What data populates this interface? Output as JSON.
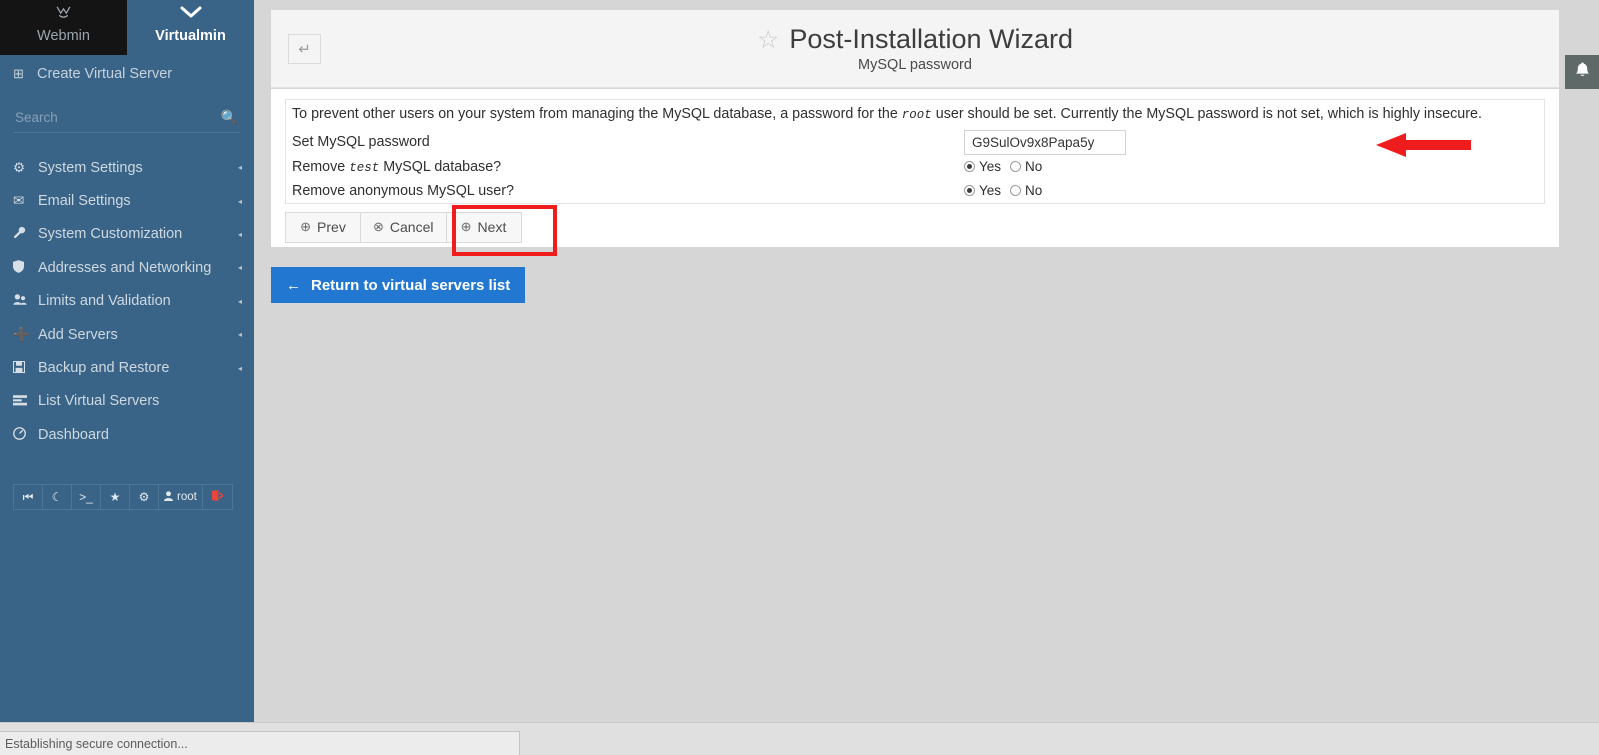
{
  "sidebar": {
    "brand_tabs": [
      {
        "label": "Webmin",
        "icon": "webmin-logo-icon",
        "active": false
      },
      {
        "label": "Virtualmin",
        "icon": "chevron-down-icon",
        "active": true
      }
    ],
    "create_virtual_server": {
      "label": "Create Virtual Server",
      "icon": "plus-square-icon"
    },
    "search": {
      "placeholder": "Search",
      "value": "",
      "icon": "search-icon"
    },
    "items": [
      {
        "label": "System Settings",
        "icon": "gear-icon",
        "arrow": "◂"
      },
      {
        "label": "Email Settings",
        "icon": "envelope-icon",
        "arrow": "◂"
      },
      {
        "label": "System Customization",
        "icon": "wrench-icon",
        "arrow": "◂"
      },
      {
        "label": "Addresses and Networking",
        "icon": "shield-icon",
        "arrow": "◂"
      },
      {
        "label": "Limits and Validation",
        "icon": "users-icon",
        "arrow": "◂"
      },
      {
        "label": "Add Servers",
        "icon": "plus-icon",
        "arrow": "◂"
      },
      {
        "label": "Backup and Restore",
        "icon": "save-icon",
        "arrow": "◂"
      },
      {
        "label": "List Virtual Servers",
        "icon": "list-icon",
        "arrow": ""
      },
      {
        "label": "Dashboard",
        "icon": "dashboard-icon",
        "arrow": ""
      }
    ],
    "mini_toolbar": [
      {
        "name": "collapse-sidebar-button",
        "glyph": "⏮",
        "label": ""
      },
      {
        "name": "night-mode-button",
        "glyph": "☾",
        "label": ""
      },
      {
        "name": "terminal-button",
        "glyph": ">_",
        "label": ""
      },
      {
        "name": "favorites-button",
        "glyph": "★",
        "label": ""
      },
      {
        "name": "theme-config-button",
        "glyph": "⚙",
        "label": ""
      },
      {
        "name": "user-button",
        "glyph": "👤",
        "label": "root"
      },
      {
        "name": "logout-button",
        "glyph": "➜",
        "label": ""
      }
    ]
  },
  "header": {
    "back_icon": "back-arrow-icon",
    "star_icon": "star-outline-icon",
    "title": "Post-Installation Wizard",
    "subtitle": "MySQL password",
    "bell_icon": "bell-icon"
  },
  "form": {
    "intro_part1": "To prevent other users on your system from managing the MySQL database, a password for the ",
    "intro_mono": "root",
    "intro_part2": " user should be set. Currently the MySQL password is not set, which is highly insecure.",
    "rows": [
      {
        "label": "Set MySQL password",
        "type": "text",
        "value": "G9SulOv9x8Papa5y"
      },
      {
        "label_pre": "Remove ",
        "label_mono": "test",
        "label_post": " MySQL database?",
        "type": "radio",
        "options": [
          {
            "label": "Yes",
            "selected": true
          },
          {
            "label": "No",
            "selected": false
          }
        ]
      },
      {
        "label_pre": "Remove anonymous MySQL user?",
        "label_mono": "",
        "label_post": "",
        "type": "radio",
        "options": [
          {
            "label": "Yes",
            "selected": true
          },
          {
            "label": "No",
            "selected": false
          }
        ]
      }
    ],
    "buttons": [
      {
        "label": "Prev",
        "icon": "circle-left-arrow-icon",
        "glyph": "⊕"
      },
      {
        "label": "Cancel",
        "icon": "circle-stop-icon",
        "glyph": "⊗"
      },
      {
        "label": "Next",
        "icon": "circle-right-arrow-icon",
        "glyph": "⊕",
        "highlighted": true
      }
    ]
  },
  "return_button": {
    "label": "Return to virtual servers list",
    "icon": "left-arrow-icon",
    "glyph": "←"
  },
  "statusbar": {
    "text": "Establishing secure connection..."
  },
  "annotations": {
    "arrow_color": "#ee1c1c",
    "highlight_color": "#ee1c1c"
  },
  "colors": {
    "sidebar_bg": "#3a6487",
    "webmin_tab_bg": "#141414",
    "primary_button": "#2277d0",
    "page_bg": "#d6d6d6"
  }
}
